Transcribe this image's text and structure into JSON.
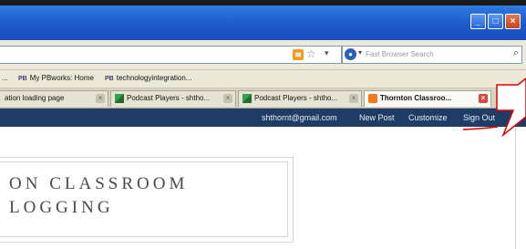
{
  "navbar": {
    "search_placeholder": "Fast Browser Search"
  },
  "bookmarks": [
    {
      "prefix": "",
      "label": "..."
    },
    {
      "prefix": "PB",
      "label": "My PBworks: Home"
    },
    {
      "prefix": "PB",
      "label": "technologyintegration..."
    }
  ],
  "tabs": [
    {
      "label": "ation loading page",
      "favicon": "none"
    },
    {
      "label": "Podcast Players - shtho...",
      "favicon": "green-icon"
    },
    {
      "label": "Podcast Players - shtho...",
      "favicon": "green-icon"
    },
    {
      "label": "Thornton Classroo...",
      "favicon": "blogger-icon"
    }
  ],
  "blogger_nav": {
    "email": "shthornt@gmail.com",
    "new_post": "New Post",
    "customize": "Customize",
    "sign_out": "Sign Out"
  },
  "blog": {
    "title_line1": "ON CLASSROOM",
    "title_line2": "LOGGING"
  },
  "colors": {
    "titlebar": "#1c57c9",
    "blogger_nav": "#1f3c67",
    "callout": "#e00000"
  }
}
